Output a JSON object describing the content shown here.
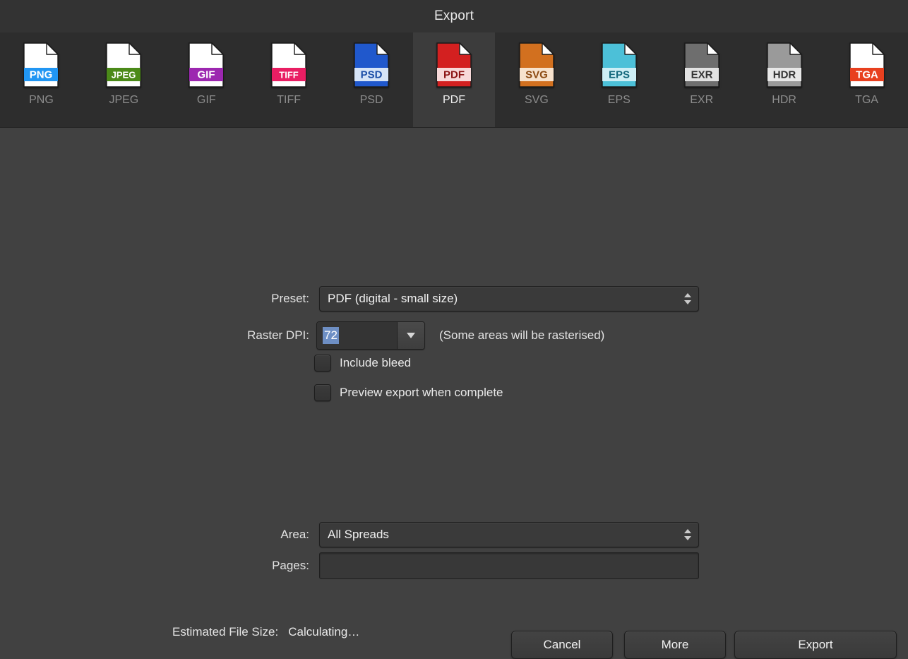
{
  "window": {
    "title": "Export"
  },
  "formats": [
    {
      "id": "png",
      "label": "PNG",
      "badge": "PNG",
      "page_color": "#ffffff",
      "band_color": "#2196f3",
      "badge_text_color": "#ffffff",
      "selected": false
    },
    {
      "id": "jpeg",
      "label": "JPEG",
      "badge": "JPEG",
      "page_color": "#ffffff",
      "band_color": "#4b8a19",
      "badge_text_color": "#ffffff",
      "selected": false
    },
    {
      "id": "gif",
      "label": "GIF",
      "badge": "GIF",
      "page_color": "#ffffff",
      "band_color": "#9c27b0",
      "badge_text_color": "#ffffff",
      "selected": false
    },
    {
      "id": "tiff",
      "label": "TIFF",
      "badge": "TIFF",
      "page_color": "#ffffff",
      "band_color": "#e91e63",
      "badge_text_color": "#ffffff",
      "selected": false
    },
    {
      "id": "psd",
      "label": "PSD",
      "badge": "PSD",
      "page_color": "#2058cc",
      "band_color": "#d6e4f7",
      "badge_text_color": "#1d4fa8",
      "selected": false
    },
    {
      "id": "pdf",
      "label": "PDF",
      "badge": "PDF",
      "page_color": "#d32020",
      "band_color": "#f7d9d9",
      "badge_text_color": "#8c1515",
      "selected": true
    },
    {
      "id": "svg",
      "label": "SVG",
      "badge": "SVG",
      "page_color": "#d2701f",
      "band_color": "#f7e2cd",
      "badge_text_color": "#8c4a12",
      "selected": false
    },
    {
      "id": "eps",
      "label": "EPS",
      "badge": "EPS",
      "page_color": "#4cc0d8",
      "band_color": "#cdeef5",
      "badge_text_color": "#14687d",
      "selected": false
    },
    {
      "id": "exr",
      "label": "EXR",
      "badge": "EXR",
      "page_color": "#6e6e6e",
      "band_color": "#e2e2e2",
      "badge_text_color": "#333333",
      "selected": false
    },
    {
      "id": "hdr",
      "label": "HDR",
      "badge": "HDR",
      "page_color": "#9a9a9a",
      "band_color": "#e8e8e8",
      "badge_text_color": "#333333",
      "selected": false
    },
    {
      "id": "tga",
      "label": "TGA",
      "badge": "TGA",
      "page_color": "#ffffff",
      "band_color": "#e8401f",
      "badge_text_color": "#ffffff",
      "selected": false
    }
  ],
  "form": {
    "preset_label": "Preset:",
    "preset_value": "PDF (digital - small size)",
    "raster_dpi_label": "Raster DPI:",
    "raster_dpi_value": "72",
    "raster_dpi_hint": "(Some areas will be rasterised)",
    "include_bleed_label": "Include bleed",
    "include_bleed_checked": false,
    "preview_export_label": "Preview export when complete",
    "preview_export_checked": false,
    "area_label": "Area:",
    "area_value": "All Spreads",
    "pages_label": "Pages:",
    "pages_value": ""
  },
  "footer": {
    "estimate_label": "Estimated File Size:",
    "estimate_value": "Calculating…",
    "cancel_label": "Cancel",
    "more_label": "More",
    "export_label": "Export"
  },
  "colors": {
    "window_bg": "#414141",
    "titlebar_bg": "#333333",
    "formatbar_bg": "#2d2d2d",
    "selected_tab_bg": "#3c3c3c",
    "selection_highlight": "#6e8fc4"
  }
}
